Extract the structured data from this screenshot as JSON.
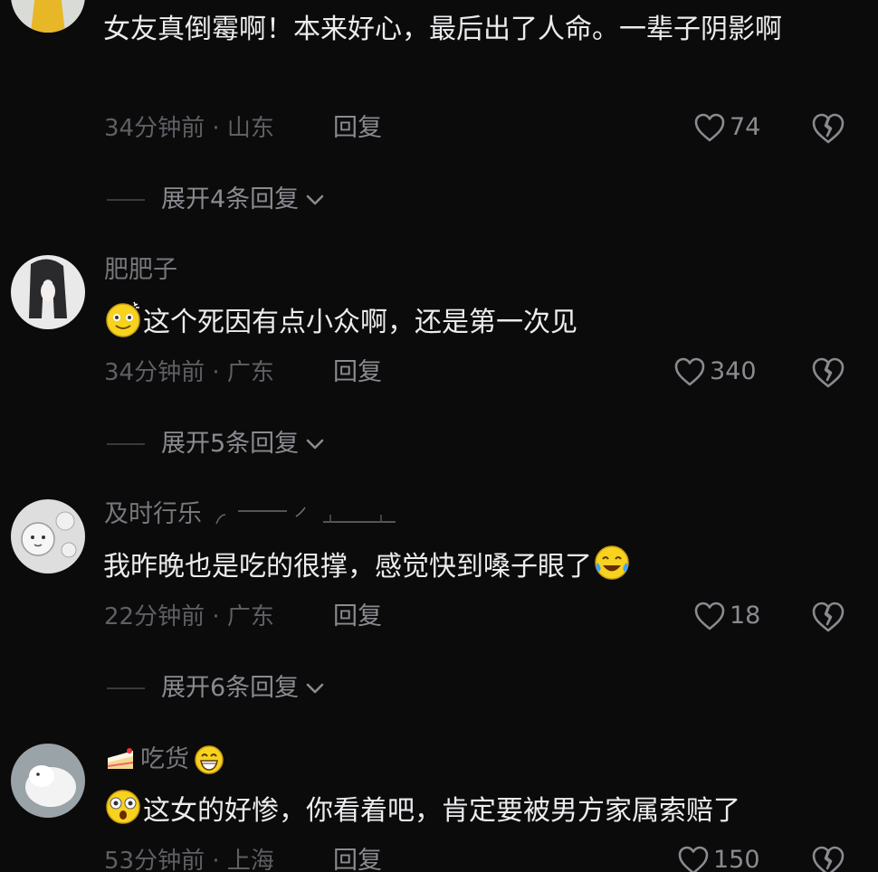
{
  "comments": [
    {
      "username": "",
      "content": "女友真倒霉啊！本来好心，最后出了人命。一辈子阴影啊",
      "time": "34分钟前",
      "location": "山东",
      "reply_label": "回复",
      "likes": "74",
      "expand_label": "展开4条回复",
      "avatar_icon": "avatar-yellow-dress"
    },
    {
      "username": "肥肥子",
      "content": "这个死因有点小众啊，还是第一次见",
      "content_emoji": "dizzy-smile-emoji",
      "time": "34分钟前",
      "location": "广东",
      "reply_label": "回复",
      "likes": "340",
      "expand_label": "展开5条回复",
      "avatar_icon": "avatar-girl-dark-hair"
    },
    {
      "username": "及时行乐",
      "content": "我昨晚也是吃的很撑，感觉快到嗓子眼了",
      "trailing_emoji": "tears-of-joy-emoji",
      "time": "22分钟前",
      "location": "广东",
      "reply_label": "回复",
      "likes": "18",
      "expand_label": "展开6条回复",
      "avatar_icon": "avatar-sheep-cartoon"
    },
    {
      "username": "吃货",
      "username_prefix_icon": "cake-icon",
      "username_suffix_icon": "grin-emoji",
      "content": "这女的好惨，你看着吧，肯定要被男方家属索赔了",
      "content_emoji": "shocked-emoji",
      "time": "53分钟前",
      "location": "上海",
      "reply_label": "回复",
      "likes": "150",
      "avatar_icon": "avatar-white-fluffy"
    }
  ],
  "separator": " · ",
  "colors": {
    "background": "#0b0b0c",
    "text": "#ececee",
    "muted": "#5f5f64",
    "action": "#8a8a90"
  }
}
